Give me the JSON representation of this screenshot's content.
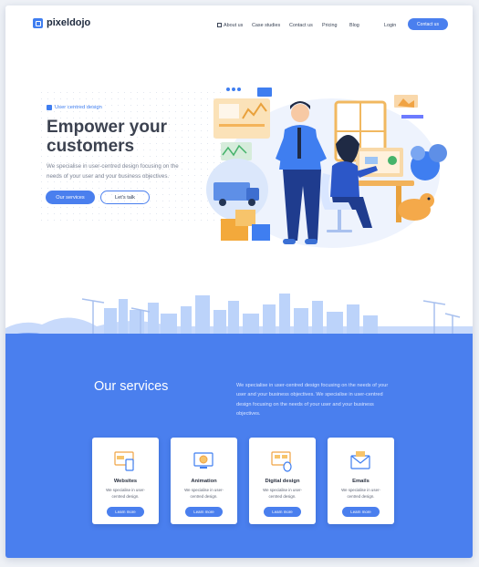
{
  "brand": {
    "name": "pixeldojo",
    "accent": "#4a7fee"
  },
  "nav": {
    "items": [
      "About us",
      "Case studies",
      "Contact us",
      "Pricing",
      "Blog"
    ],
    "login": "Login",
    "cta": "Contact us"
  },
  "hero": {
    "eyebrow": "User centred design",
    "title": "Empower your customers",
    "subtitle": "We specialise in user-centred design focusing on the needs of your user and your business objectives.",
    "primary_button": "Our services",
    "secondary_button": "Let's talk"
  },
  "services": {
    "title": "Our services",
    "description": "We specialise in user-centred design focusing on the needs of your user and your business objectives. We specialise in user-centred design focusing on the needs of your user and your business objectives.",
    "cards": [
      {
        "title": "Websites",
        "text": "We specialise in user-centred design.",
        "button": "Learn more",
        "icon": "website-icon"
      },
      {
        "title": "Animation",
        "text": "We specialise in user-centred design.",
        "button": "Learn more",
        "icon": "animation-icon"
      },
      {
        "title": "Digital design",
        "text": "We specialise in user-centred design.",
        "button": "Learn more",
        "icon": "digital-design-icon"
      },
      {
        "title": "Emails",
        "text": "We specialise in user-centred design.",
        "button": "Learn more",
        "icon": "email-icon"
      }
    ]
  }
}
